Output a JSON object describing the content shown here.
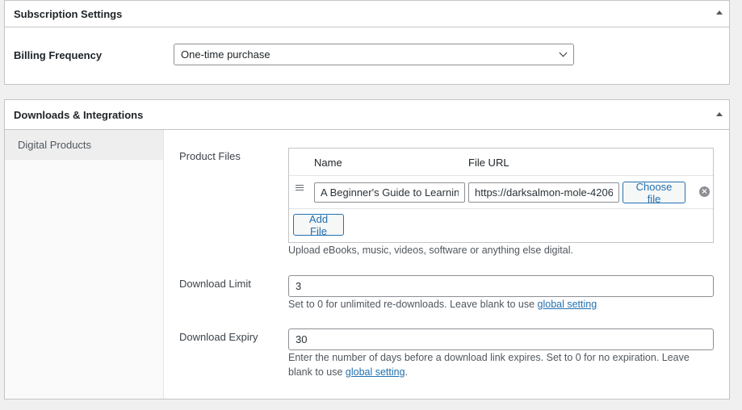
{
  "subscription": {
    "title": "Subscription Settings",
    "billing_label": "Billing Frequency",
    "billing_value": "One-time purchase"
  },
  "downloads": {
    "title": "Downloads & Integrations",
    "side_tab": "Digital Products",
    "product_files_label": "Product Files",
    "col_name": "Name",
    "col_url": "File URL",
    "file_name": "A Beginner's Guide to Learning",
    "file_url": "https://darksalmon-mole-4206",
    "choose_file": "Choose file",
    "add_file": "Add File",
    "files_help": "Upload eBooks, music, videos, software or anything else digital.",
    "limit_label": "Download Limit",
    "limit_value": "3",
    "limit_help_prefix": "Set to 0 for unlimited re-downloads. Leave blank to use ",
    "limit_help_link": "global setting",
    "expiry_label": "Download Expiry",
    "expiry_value": "30",
    "expiry_help_prefix": "Enter the number of days before a download link expires. Set to 0 for no expiration. Leave blank to use ",
    "expiry_help_link": "global setting",
    "expiry_help_suffix": "."
  },
  "icons": {
    "collapse": "triangle-up-icon",
    "dropdown": "chevron-down-icon",
    "drag": "drag-handle-icon",
    "remove": "remove-icon"
  }
}
